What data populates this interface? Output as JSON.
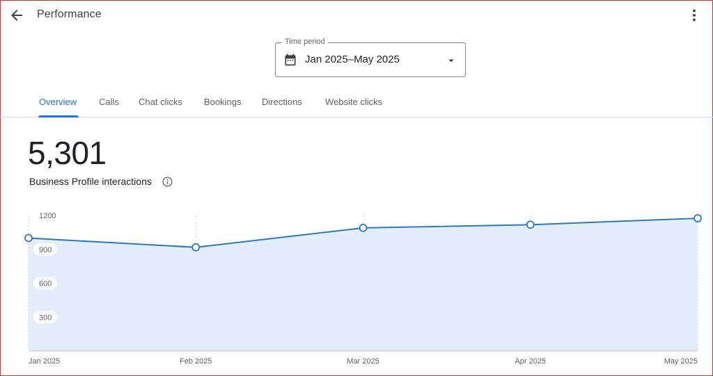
{
  "header": {
    "title": "Performance",
    "back_icon": "arrow-back-icon",
    "more_icon": "more-vert-icon"
  },
  "time_period": {
    "label": "Time period",
    "value": "Jan 2025–May 2025",
    "icon": "calendar-icon"
  },
  "tabs": [
    {
      "label": "Overview",
      "active": true
    },
    {
      "label": "Calls",
      "active": false
    },
    {
      "label": "Chat clicks",
      "active": false
    },
    {
      "label": "Bookings",
      "active": false
    },
    {
      "label": "Directions",
      "active": false
    },
    {
      "label": "Website clicks",
      "active": false
    }
  ],
  "summary": {
    "total": "5,301",
    "label": "Business Profile interactions",
    "info_icon": "info-icon"
  },
  "colors": {
    "accent": "#1a73e8",
    "line": "#2b78c2",
    "area": "#e3edfc"
  },
  "chart_data": {
    "type": "area",
    "categories": [
      "Jan 2025",
      "Feb 2025",
      "Mar 2025",
      "Apr 2025",
      "May 2025"
    ],
    "x_tick_labels": [
      "Jan 2025",
      "Feb 2025",
      "Mar 2025",
      "Apr 2025",
      "May 2025"
    ],
    "series": [
      {
        "values": [
          1000,
          918,
          1090,
          1118,
          1175
        ]
      }
    ],
    "y_ticks": [
      300,
      600,
      900,
      1200
    ],
    "y_tick_labels": [
      "300",
      "600",
      "900",
      "1200"
    ],
    "ylim": [
      0,
      1200
    ],
    "grid": "vertical dotted",
    "title": "",
    "xlabel": "",
    "ylabel": ""
  }
}
